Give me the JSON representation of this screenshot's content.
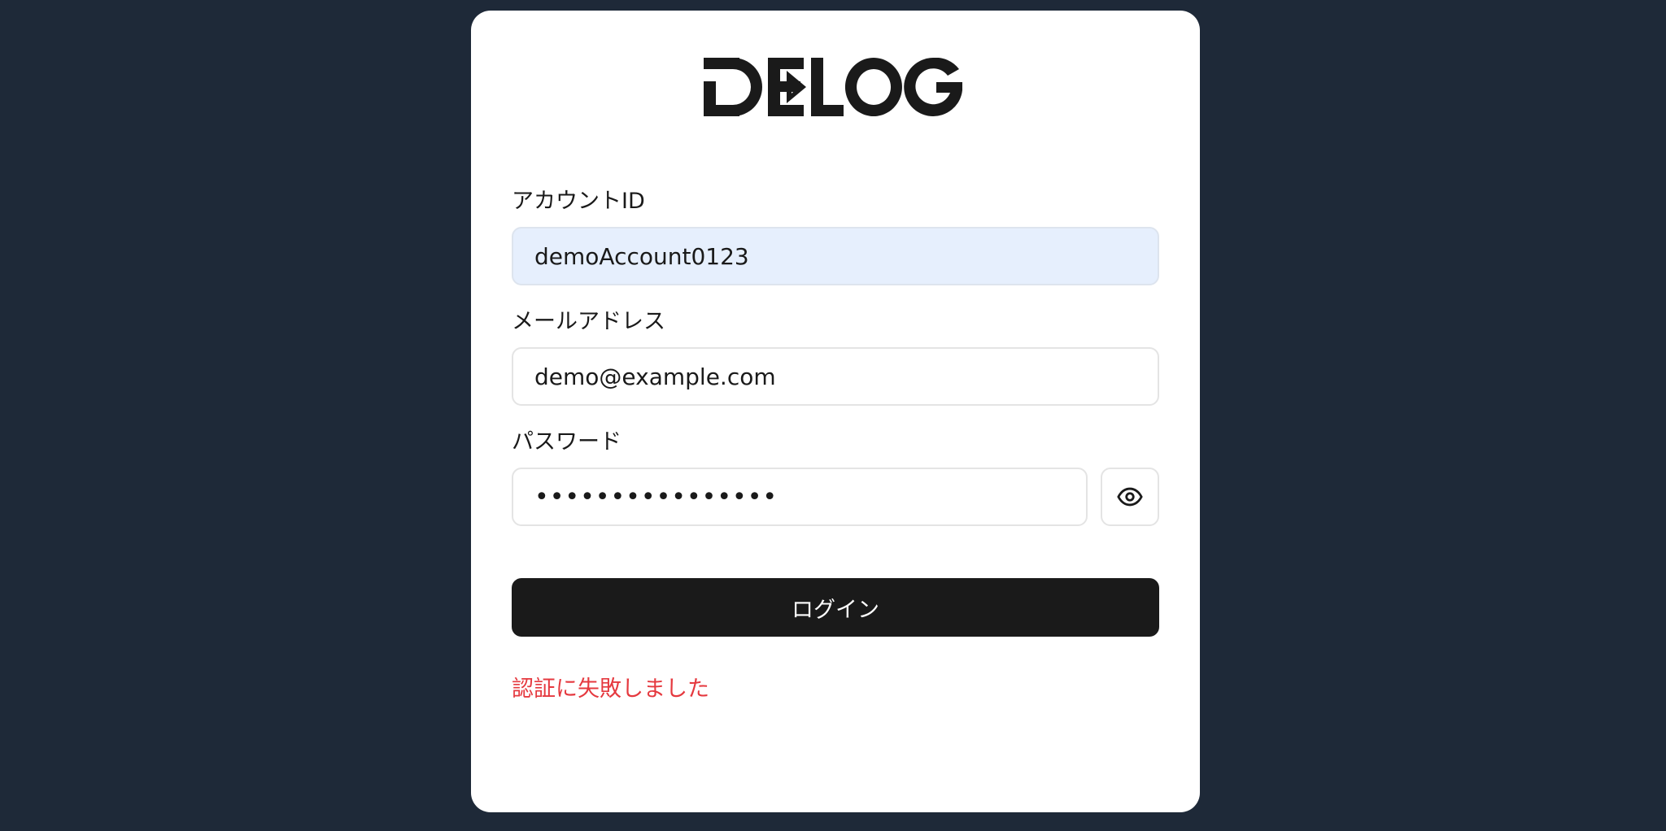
{
  "brand": {
    "logo_text": "DE▸LOGs"
  },
  "form": {
    "account_id": {
      "label": "アカウントID",
      "value": "demoAccount0123"
    },
    "email": {
      "label": "メールアドレス",
      "value": "demo@example.com"
    },
    "password": {
      "label": "パスワード",
      "masked_value": "••••••••••••••••"
    },
    "toggle_visibility_icon": "eye-icon",
    "login_label": "ログイン",
    "error_message": "認証に失敗しました"
  },
  "colors": {
    "background": "#1e2938",
    "card": "#ffffff",
    "autofill": "#e6effd",
    "button": "#1a1a1a",
    "error": "#e5393f"
  }
}
